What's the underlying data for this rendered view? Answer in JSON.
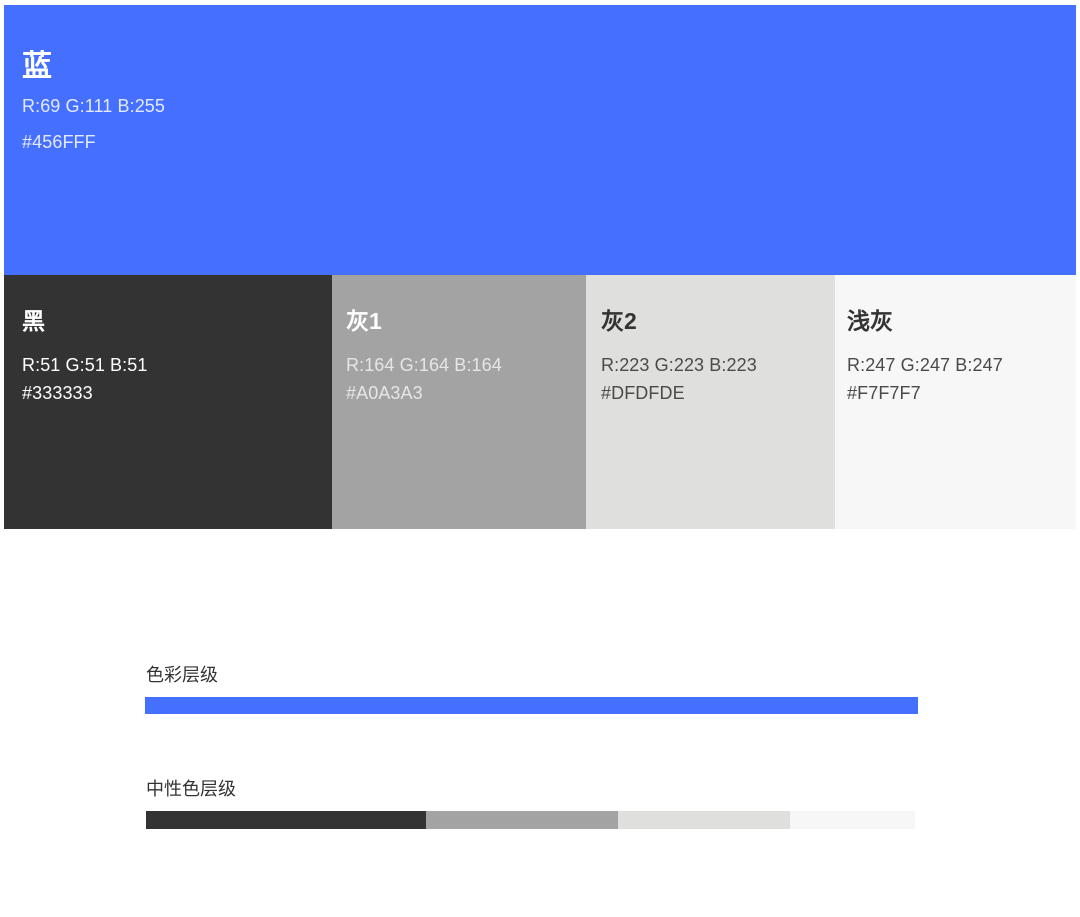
{
  "swatches": {
    "blue": {
      "name": "蓝",
      "rgb": "R:69   G:111   B:255",
      "hex": "#456FFF",
      "color": "#456FFF"
    },
    "black": {
      "name": "黑",
      "rgb": "R:51   G:51   B:51",
      "hex": "#333333",
      "color": "#333333"
    },
    "gray1": {
      "name": "灰1",
      "rgb": "R:164   G:164   B:164",
      "hex": "#A0A3A3",
      "color": "#A3A3A3"
    },
    "gray2": {
      "name": "灰2",
      "rgb": "R:223   G:223   B:223",
      "hex": "#DFDFDE",
      "color": "#DFDFDE"
    },
    "lightgray": {
      "name": "浅灰",
      "rgb": "R:247   G:247   B:247",
      "hex": "#F7F7F7",
      "color": "#F7F7F7"
    }
  },
  "levels": {
    "color_title": "色彩层级",
    "neutral_title": "中性色层级"
  }
}
